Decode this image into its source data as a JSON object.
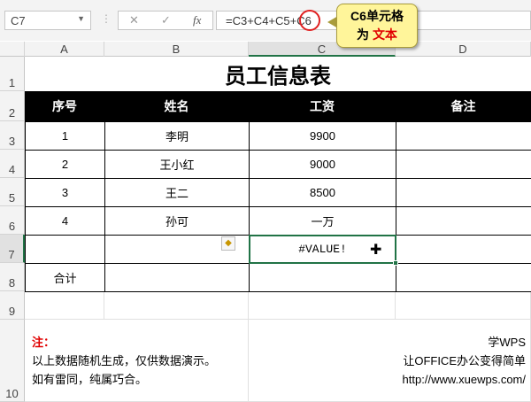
{
  "toolbar": {
    "name_box": "C7",
    "cancel_icon": "✕",
    "confirm_icon": "✓",
    "fx_label": "fx",
    "formula": "=C3+C4+C5+",
    "formula_highlight": "C6"
  },
  "callout": {
    "line1": "C6单元格",
    "line2_prefix": "为 ",
    "line2_highlight": "文本"
  },
  "columns": [
    "A",
    "B",
    "C",
    "D"
  ],
  "rows": [
    "1",
    "2",
    "3",
    "4",
    "5",
    "6",
    "7",
    "8",
    "9",
    "10"
  ],
  "sheet": {
    "title": "员工信息表",
    "headers": [
      "序号",
      "姓名",
      "工资",
      "备注"
    ],
    "data": [
      [
        "1",
        "李明",
        "9900",
        ""
      ],
      [
        "2",
        "王小红",
        "9000",
        ""
      ],
      [
        "3",
        "王二",
        "8500",
        ""
      ],
      [
        "4",
        "孙可",
        "一万",
        ""
      ]
    ],
    "row7_c": "#VALUE!",
    "total_label": "合计"
  },
  "note": {
    "label": "注：",
    "line1": "以上数据随机生成，仅供数据演示。",
    "line2": "如有雷同，纯属巧合。"
  },
  "brand": {
    "line1": "学WPS",
    "line2": "让OFFICE办公变得简单",
    "line3": "http://www.xuewps.com/"
  }
}
